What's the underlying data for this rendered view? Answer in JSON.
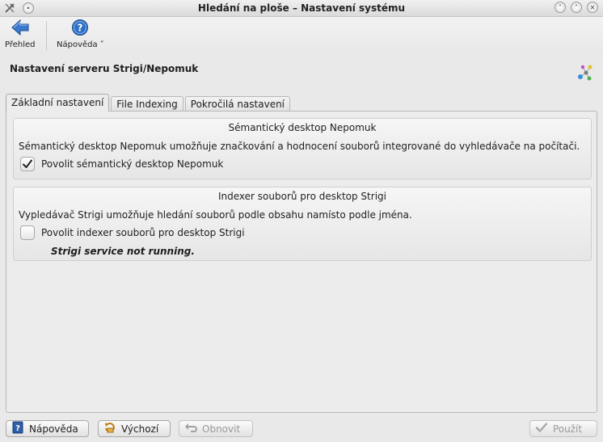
{
  "window": {
    "title": "Hledání na ploše – Nastavení systému"
  },
  "toolbar": {
    "overview_label": "Přehled",
    "help_label": "Nápověda"
  },
  "header": {
    "title": "Nastavení serveru Strigi/Nepomuk"
  },
  "tabs": [
    {
      "label": "Základní nastavení",
      "active": true
    },
    {
      "label": "File Indexing",
      "active": false
    },
    {
      "label": "Pokročilá nastavení",
      "active": false
    }
  ],
  "nepomuk_group": {
    "title": "Sémantický desktop Nepomuk",
    "description": "Sémantický desktop Nepomuk umožňuje značkování a hodnocení souborů integrované do vyhledávače na počítači.",
    "checkbox_label": "Povolit sémantický desktop Nepomuk",
    "checked": true
  },
  "strigi_group": {
    "title": "Indexer souborů pro desktop Strigi",
    "description": "Vypledávač Strigi umožňuje hledání souborů podle obsahu namísto podle jména.",
    "checkbox_label": "Povolit indexer souborů pro desktop Strigi",
    "checked": false,
    "status": "Strigi service not running."
  },
  "buttons": {
    "help": "Nápověda",
    "defaults": "Výchozí",
    "reset": "Obnovit",
    "apply": "Použít"
  },
  "colors": {
    "accent_blue": "#2d6fc4",
    "back_arrow": "#3b78d0"
  }
}
